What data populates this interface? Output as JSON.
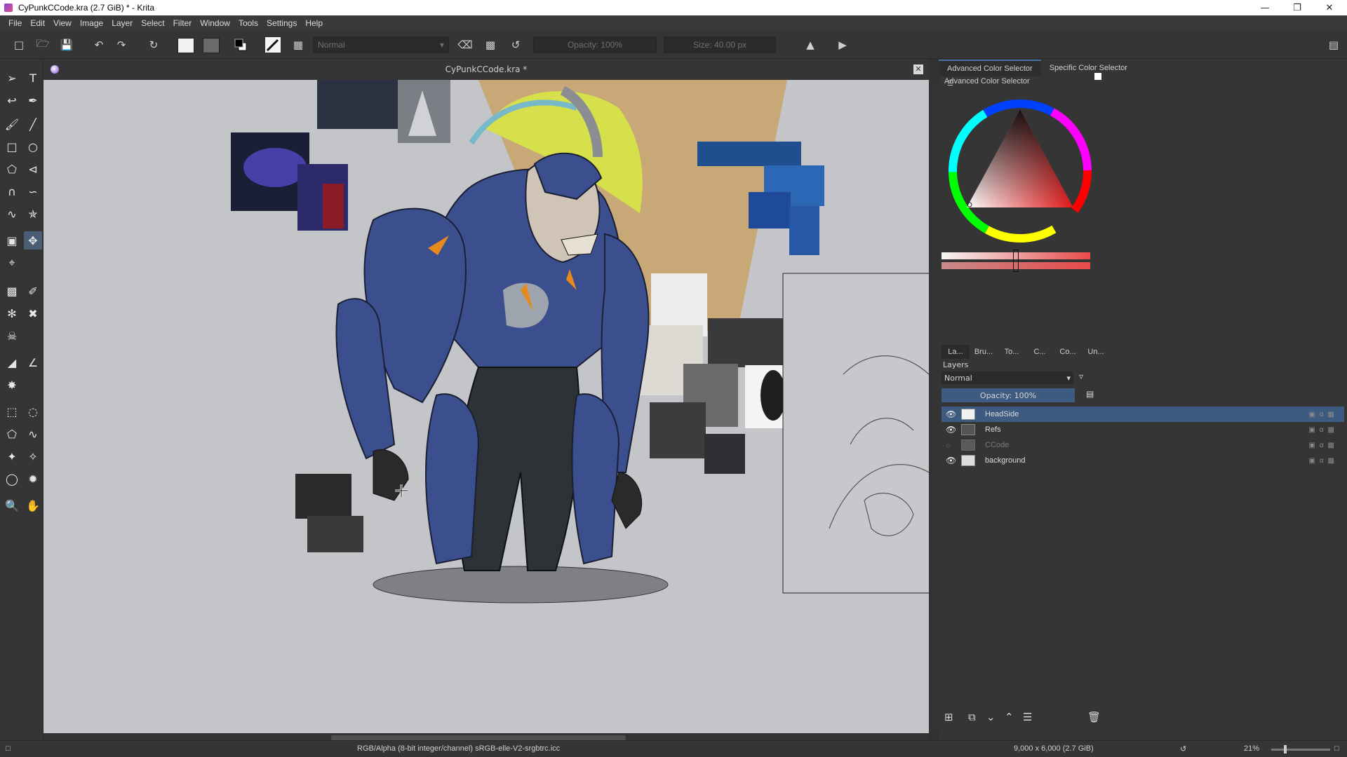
{
  "window": {
    "title": "CyPunkCCode.kra (2.7 GiB) * - Krita",
    "controls": [
      "minimize-icon",
      "restore-icon",
      "close-icon"
    ]
  },
  "menu": [
    "File",
    "Edit",
    "View",
    "Image",
    "Layer",
    "Select",
    "Filter",
    "Window",
    "Tools",
    "Settings",
    "Help"
  ],
  "toolbar": {
    "blend_mode": "Normal",
    "opacity": "Opacity: 100%",
    "size": "Size: 40.00 px"
  },
  "document": {
    "tab_title": "CyPunkCCode.kra *"
  },
  "dock": {
    "tabs": [
      "Advanced Color Selector",
      "Specific Color Selector"
    ],
    "panel_title": "Advanced Color Selector",
    "subtabs": [
      "La...",
      "Bru...",
      "To...",
      "C...",
      "Co...",
      "Un..."
    ],
    "layers_title": "Layers",
    "layers_blend": "Normal",
    "layers_opacity": "Opacity:  100%",
    "layers": [
      {
        "name": "HeadSide",
        "visible": true,
        "selected": true
      },
      {
        "name": "Refs",
        "visible": true,
        "selected": false
      },
      {
        "name": "CCode",
        "visible": false,
        "selected": false
      },
      {
        "name": "background",
        "visible": true,
        "selected": false
      }
    ]
  },
  "status": {
    "color_space": "RGB/Alpha (8-bit integer/channel)  sRGB-elle-V2-srgbtrc.icc",
    "dimensions": "9,000 x 6,000 (2.7 GiB)",
    "zoom": "21%"
  },
  "colors": {
    "accent": "#4a6fa5",
    "selected_layer": "#3d5a80",
    "canvas_bg": "#c3c5c8",
    "armor_blue": "#3b4f8f"
  }
}
